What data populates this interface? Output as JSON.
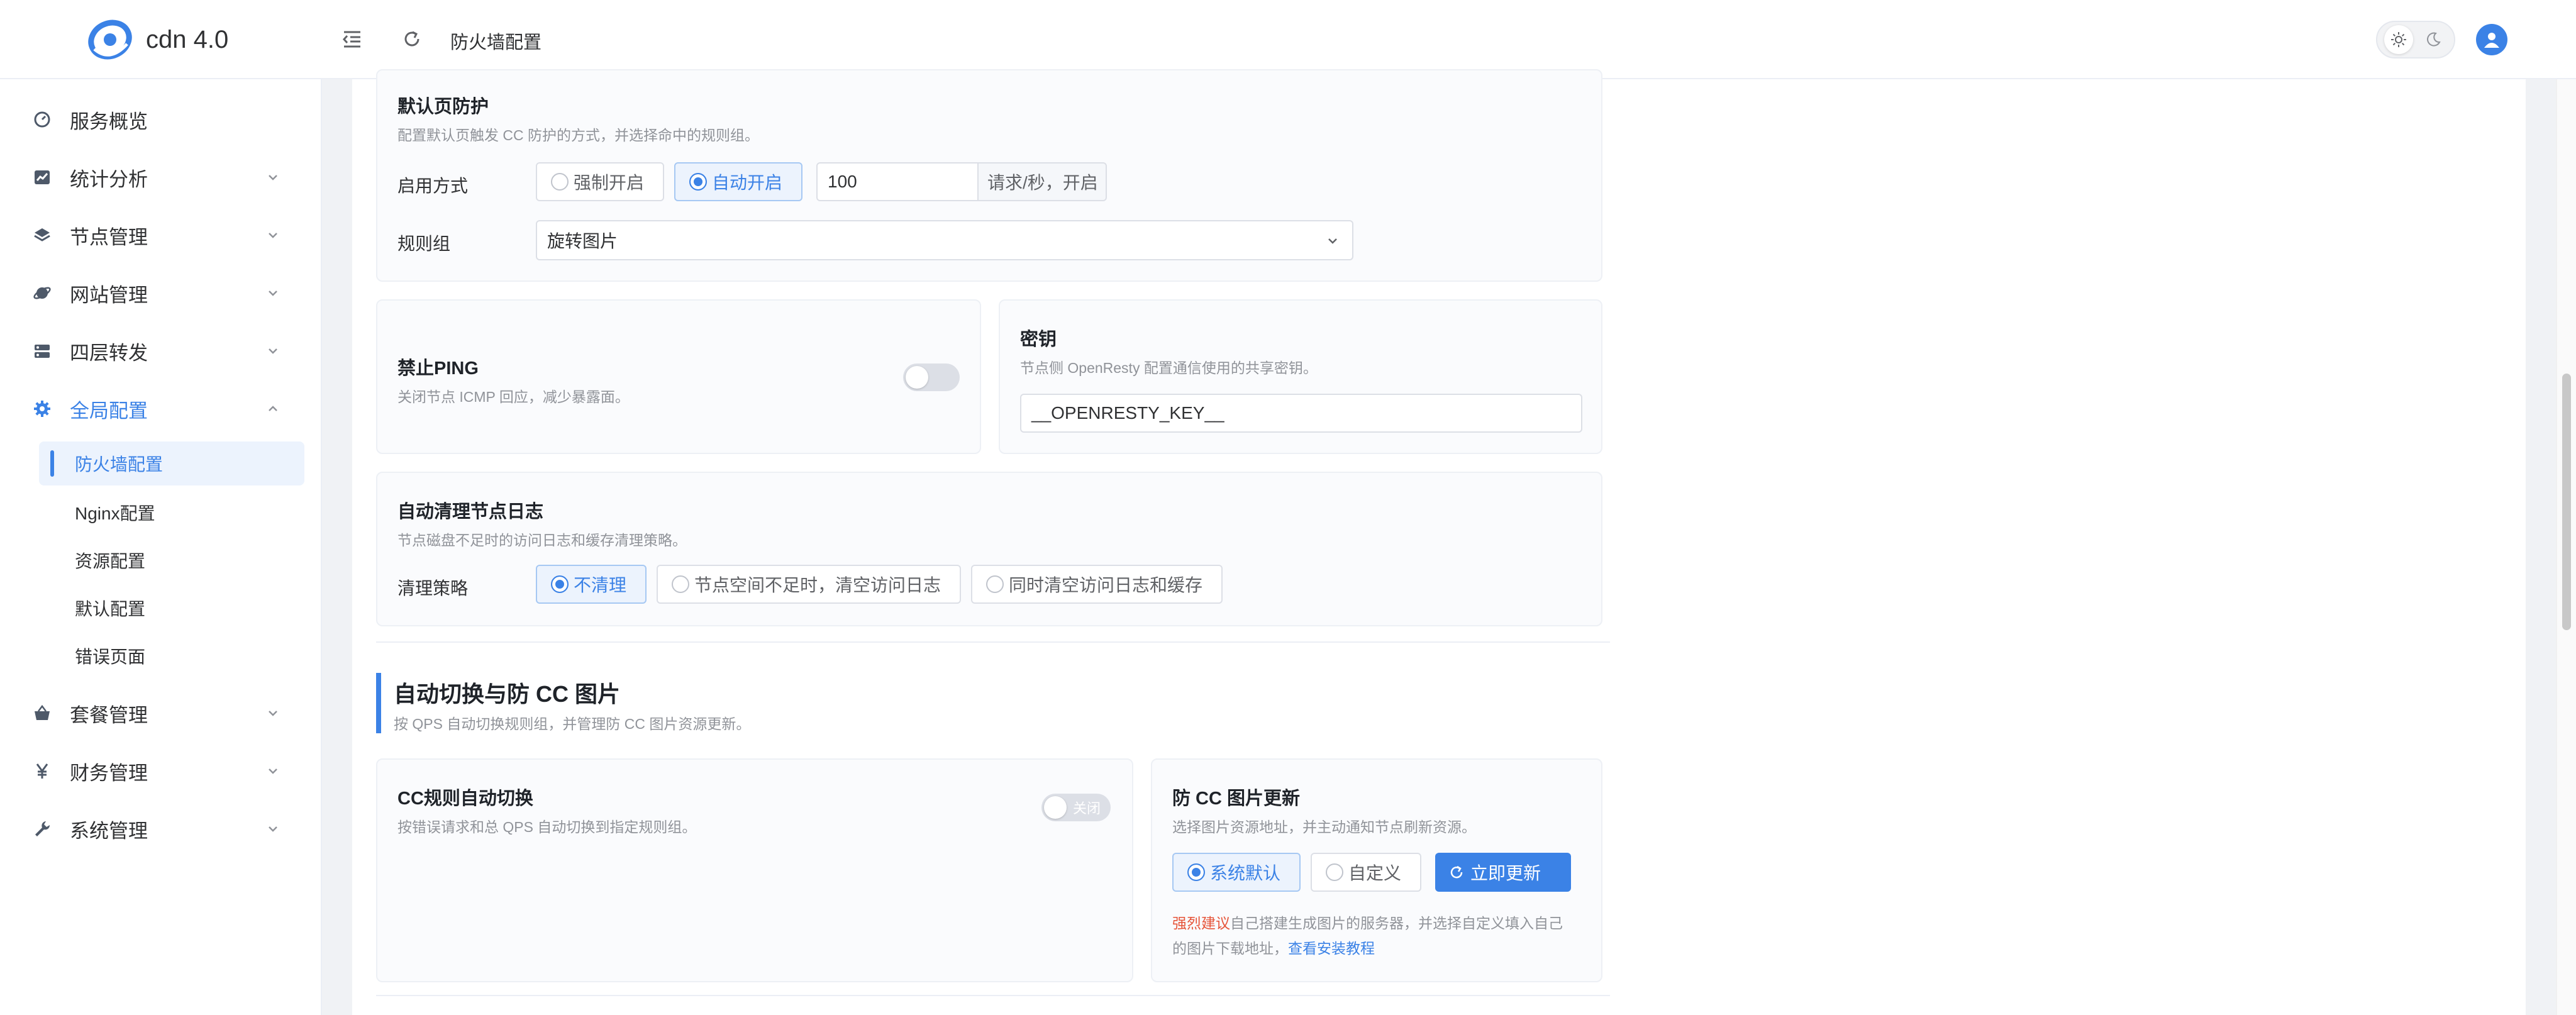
{
  "app": {
    "name": "cdn 4.0"
  },
  "header": {
    "page_title": "防火墙配置"
  },
  "sidebar": {
    "items": [
      {
        "label": "服务概览",
        "icon": "dashboard-icon"
      },
      {
        "label": "统计分析",
        "icon": "chart-icon"
      },
      {
        "label": "节点管理",
        "icon": "layers-icon"
      },
      {
        "label": "网站管理",
        "icon": "globe-icon"
      },
      {
        "label": "四层转发",
        "icon": "forward-icon"
      },
      {
        "label": "全局配置",
        "icon": "gear-icon"
      },
      {
        "label": "套餐管理",
        "icon": "basket-icon"
      },
      {
        "label": "财务管理",
        "icon": "yuan-icon"
      },
      {
        "label": "系统管理",
        "icon": "wrench-icon"
      }
    ],
    "sub_items": [
      "防火墙配置",
      "Nginx配置",
      "资源配置",
      "默认配置",
      "错误页面"
    ]
  },
  "default_page": {
    "title": "默认页防护",
    "desc": "配置默认页触发 CC 防护的方式，并选择命中的规则组。",
    "mode_label": "启用方式",
    "mode_options": [
      "强制开启",
      "自动开启"
    ],
    "threshold_value": "100",
    "threshold_unit": "请求/秒，开启",
    "rule_group_label": "规则组",
    "rule_group_value": "旋转图片"
  },
  "ping": {
    "title": "禁止PING",
    "desc": "关闭节点 ICMP 回应，减少暴露面。"
  },
  "secret": {
    "title": "密钥",
    "desc": "节点侧 OpenResty 配置通信使用的共享密钥。",
    "value": "__OPENRESTY_KEY__"
  },
  "log_cleanup": {
    "title": "自动清理节点日志",
    "desc": "节点磁盘不足时的访问日志和缓存清理策略。",
    "strategy_label": "清理策略",
    "options": [
      "不清理",
      "节点空间不足时，清空访问日志",
      "同时清空访问日志和缓存"
    ]
  },
  "section": {
    "title": "自动切换与防 CC 图片",
    "desc": "按 QPS 自动切换规则组，并管理防 CC 图片资源更新。"
  },
  "cc_switch": {
    "title": "CC规则自动切换",
    "desc": "按错误请求和总 QPS 自动切换到指定规则组。",
    "switch_text": "关闭"
  },
  "cc_image": {
    "title": "防 CC 图片更新",
    "desc": "选择图片资源地址，并主动通知节点刷新资源。",
    "options": [
      "系统默认",
      "自定义"
    ],
    "update_button": "立即更新",
    "note_warn": "强烈建议",
    "note_line1": "自己搭建生成图片的服务器，并选择自定义填入自己",
    "note_line2": "的图片下载地址，",
    "note_link": "查看安装教程"
  },
  "colors": {
    "accent": "#3b82e6",
    "warn": "#e6553a"
  }
}
